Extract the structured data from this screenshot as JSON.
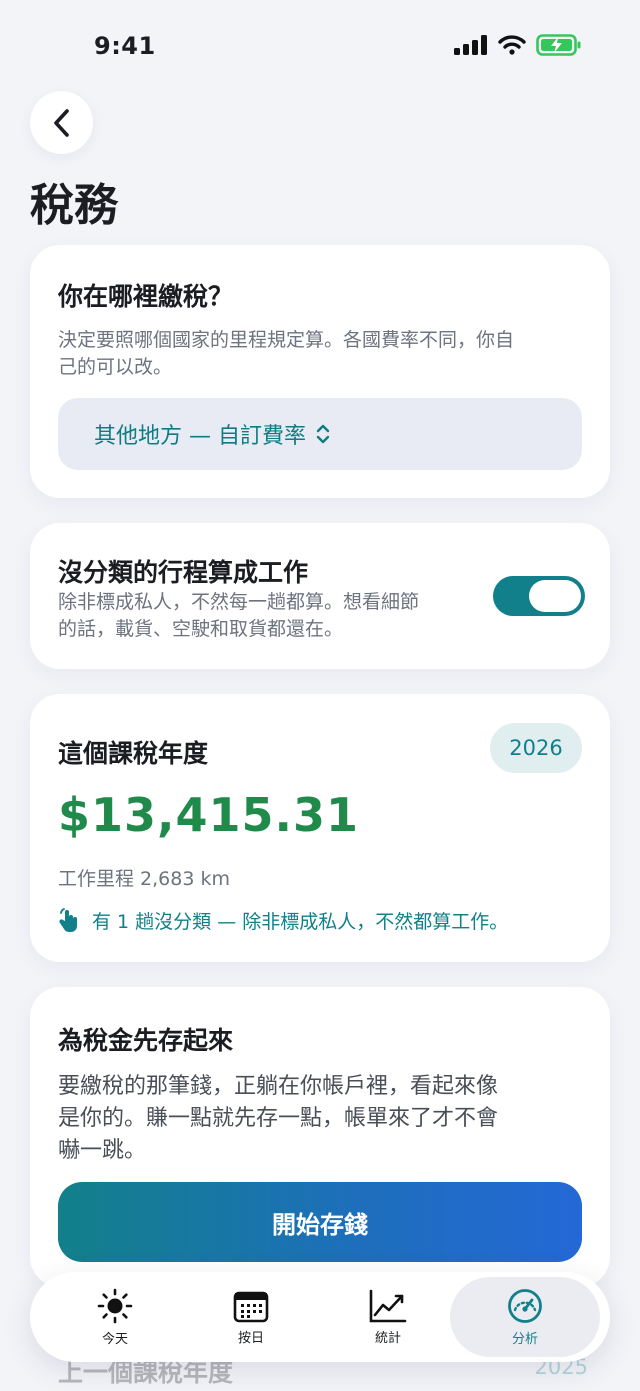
{
  "status": {
    "time": "9:41"
  },
  "header": {
    "title": "稅務"
  },
  "region_card": {
    "title": "你在哪裡繳稅？",
    "description_line1": "決定要照哪個國家的里程規定算。各國費率不同，你自",
    "description_line2": "己的可以改。",
    "select_value": "其他地方 — 自訂費率"
  },
  "toggle_card": {
    "title": "沒分類的行程算成工作",
    "description_line1": "除非標成私人，不然每一趟都算。想看細節",
    "description_line2": "的話，載貨、空駛和取貨都還在。",
    "enabled": true
  },
  "tax_year_card": {
    "title": "這個課稅年度",
    "year": "2026",
    "amount": "$13,415.31",
    "work_miles": "工作里程 2,683 km",
    "hint": "有 1 趟沒分類 — 除非標成私人，不然都算工作。"
  },
  "savings_card": {
    "title": "為稅金先存起來",
    "body_line1": "要繳稅的那筆錢，正躺在你帳戶裡，看起來像",
    "body_line2": "是你的。賺一點就先存一點，帳單來了才不會",
    "body_line3": "嚇一跳。",
    "button_label": "開始存錢"
  },
  "previous_year": {
    "title": "上一個課稅年度",
    "year": "2025"
  },
  "tab_bar": {
    "tabs": [
      {
        "label": "今天",
        "icon": "sun-icon"
      },
      {
        "label": "按日",
        "icon": "calendar-icon"
      },
      {
        "label": "統計",
        "icon": "chart-icon"
      },
      {
        "label": "分析",
        "icon": "gauge-icon"
      }
    ],
    "active_index": 3
  },
  "colors": {
    "accent": "#12808a",
    "money": "#1f8a4a",
    "button_end": "#2468d6"
  }
}
